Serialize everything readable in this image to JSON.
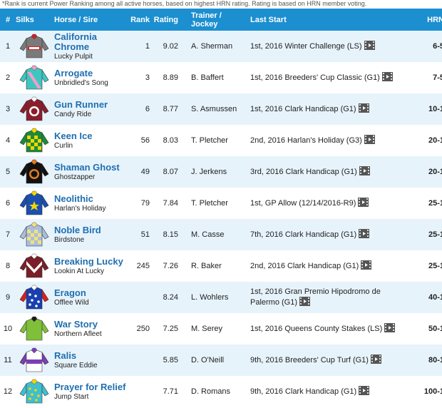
{
  "note": "*Rank is current Power Ranking among all active horses, based on highest HRN rating. Rating is based on HRN member voting.",
  "headers": {
    "num": "#",
    "silks": "Silks",
    "horse": "Horse / Sire",
    "rank": "Rank",
    "rating": "Rating",
    "trainer_line1": "Trainer /",
    "trainer_line2": "Jockey",
    "last_start": "Last Start",
    "hrn": "HRN"
  },
  "rows": [
    {
      "num": "1",
      "horse": "California Chrome",
      "sire": "Lucky Pulpit",
      "rank": "1",
      "rating": "9.02",
      "trainer": "A. Sherman",
      "last_start": "1st, 2016 Winter Challenge (LS)",
      "hrn": "6-5",
      "silk": {
        "body": "#7a7a7a",
        "sleeve": "#7a7a7a",
        "accent": "#cc2222",
        "pattern": "chrome"
      }
    },
    {
      "num": "2",
      "horse": "Arrogate",
      "sire": "Unbridled's Song",
      "rank": "3",
      "rating": "8.89",
      "trainer": "B. Baffert",
      "last_start": "1st, 2016 Breeders' Cup Classic (G1)",
      "hrn": "7-5",
      "silk": {
        "body": "#3fc6c0",
        "sleeve": "#3fc6c0",
        "accent": "#f0a0c8",
        "pattern": "sash"
      }
    },
    {
      "num": "3",
      "horse": "Gun Runner",
      "sire": "Candy Ride",
      "rank": "6",
      "rating": "8.77",
      "trainer": "S. Asmussen",
      "last_start": "1st, 2016 Clark Handicap (G1)",
      "hrn": "10-1",
      "silk": {
        "body": "#8b1e2b",
        "sleeve": "#8b1e2b",
        "accent": "#ffffff",
        "pattern": "circle"
      }
    },
    {
      "num": "4",
      "horse": "Keen Ice",
      "sire": "Curlin",
      "rank": "56",
      "rating": "8.03",
      "trainer": "T. Pletcher",
      "last_start": "2nd, 2016 Harlan's Holiday (G3)",
      "hrn": "20-1",
      "silk": {
        "body": "#1d8a3a",
        "sleeve": "#1d8a3a",
        "accent": "#f2d600",
        "pattern": "checks"
      }
    },
    {
      "num": "5",
      "horse": "Shaman Ghost",
      "sire": "Ghostzapper",
      "rank": "49",
      "rating": "8.07",
      "trainer": "J. Jerkens",
      "last_start": "3rd, 2016 Clark Handicap (G1)",
      "hrn": "20-1",
      "silk": {
        "body": "#111111",
        "sleeve": "#111111",
        "accent": "#e07a1a",
        "pattern": "circle"
      }
    },
    {
      "num": "6",
      "horse": "Neolithic",
      "sire": "Harlan's Holiday",
      "rank": "79",
      "rating": "7.84",
      "trainer": "T. Pletcher",
      "last_start": "1st, GP Allow (12/14/2016-R9)",
      "hrn": "25-1",
      "silk": {
        "body": "#1a4fb0",
        "sleeve": "#1a4fb0",
        "accent": "#f2d600",
        "pattern": "star"
      }
    },
    {
      "num": "7",
      "horse": "Noble Bird",
      "sire": "Birdstone",
      "rank": "51",
      "rating": "8.15",
      "trainer": "M. Casse",
      "last_start": "7th, 2016 Clark Handicap (G1)",
      "hrn": "25-1",
      "silk": {
        "body": "#a9bde0",
        "sleeve": "#a9bde0",
        "accent": "#f2e27a",
        "pattern": "checks"
      }
    },
    {
      "num": "8",
      "horse": "Breaking Lucky",
      "sire": "Lookin At Lucky",
      "rank": "245",
      "rating": "7.26",
      "trainer": "R. Baker",
      "last_start": "2nd, 2016 Clark Handicap (G1)",
      "hrn": "25-1",
      "silk": {
        "body": "#7a1f2a",
        "sleeve": "#7a1f2a",
        "accent": "#ffffff",
        "pattern": "chevron"
      }
    },
    {
      "num": "9",
      "horse": "Eragon",
      "sire": "Offlee Wild",
      "rank": "",
      "rating": "8.24",
      "trainer": "L. Wohlers",
      "last_start": "1st, 2016 Gran Premio Hipodromo de Palermo (G1)",
      "hrn": "40-1",
      "silk": {
        "body": "#1a3fb0",
        "sleeve": "#d92020",
        "accent": "#ffffff",
        "pattern": "dots"
      }
    },
    {
      "num": "10",
      "horse": "War Story",
      "sire": "Northern Afleet",
      "rank": "250",
      "rating": "7.25",
      "trainer": "M. Serey",
      "last_start": "1st, 2016 Queens County Stakes (LS)",
      "hrn": "50-1",
      "silk": {
        "body": "#7fbf3a",
        "sleeve": "#7fbf3a",
        "accent": "#1a1a1a",
        "pattern": "plain"
      }
    },
    {
      "num": "11",
      "horse": "Ralis",
      "sire": "Square Eddie",
      "rank": "",
      "rating": "5.85",
      "trainer": "D. O'Neill",
      "last_start": "9th, 2016 Breeders' Cup Turf (G1)",
      "hrn": "80-1",
      "silk": {
        "body": "#ffffff",
        "sleeve": "#7a3fb0",
        "accent": "#7a3fb0",
        "pattern": "band"
      }
    },
    {
      "num": "12",
      "horse": "Prayer for Relief",
      "sire": "Jump Start",
      "rank": "",
      "rating": "7.71",
      "trainer": "D. Romans",
      "last_start": "9th, 2016 Clark Handicap (G1)",
      "hrn": "100-1",
      "silk": {
        "body": "#3fbfd0",
        "sleeve": "#3fbfd0",
        "accent": "#f2d600",
        "pattern": "dots"
      }
    }
  ]
}
